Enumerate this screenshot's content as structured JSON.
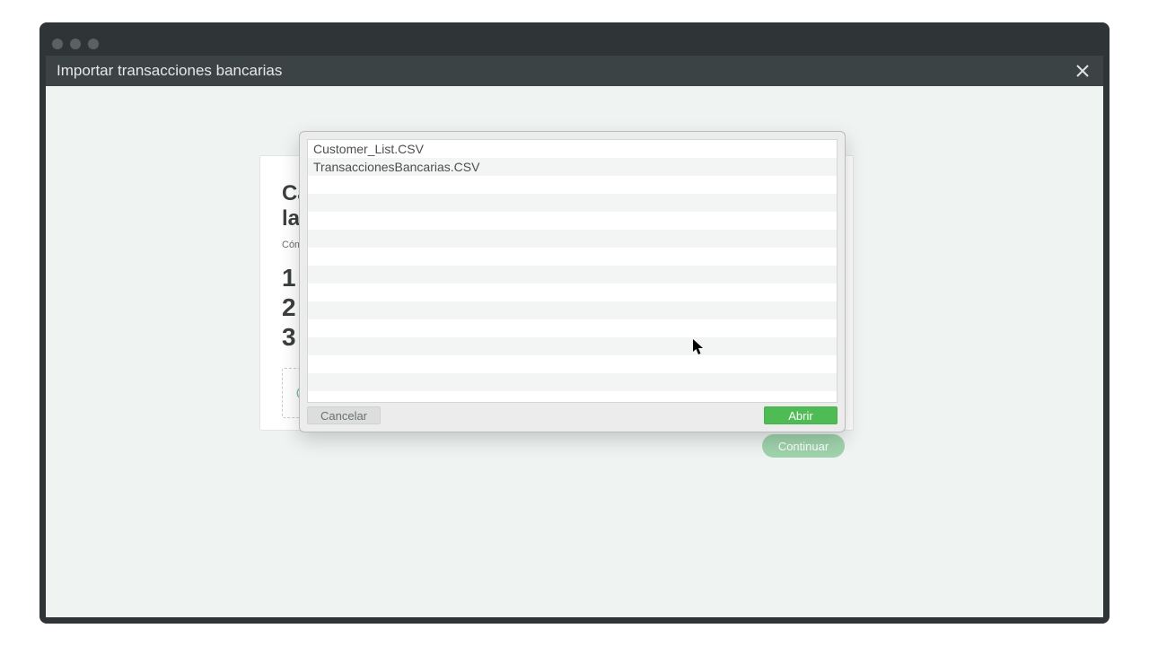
{
  "window": {
    "title": "Importar transacciones bancarias"
  },
  "wizard": {
    "heading_line1": "Ca",
    "heading_line2": "la",
    "subtitle": "Cóm",
    "step1": "1",
    "step2": "2",
    "step3": "3",
    "continue_label": "Continuar"
  },
  "filepicker": {
    "files": [
      {
        "name": "Customer_List.CSV",
        "selected": false
      },
      {
        "name": "TransaccionesBancarias.CSV",
        "selected": true
      }
    ],
    "cancel_label": "Cancelar",
    "open_label": "Abrir"
  }
}
